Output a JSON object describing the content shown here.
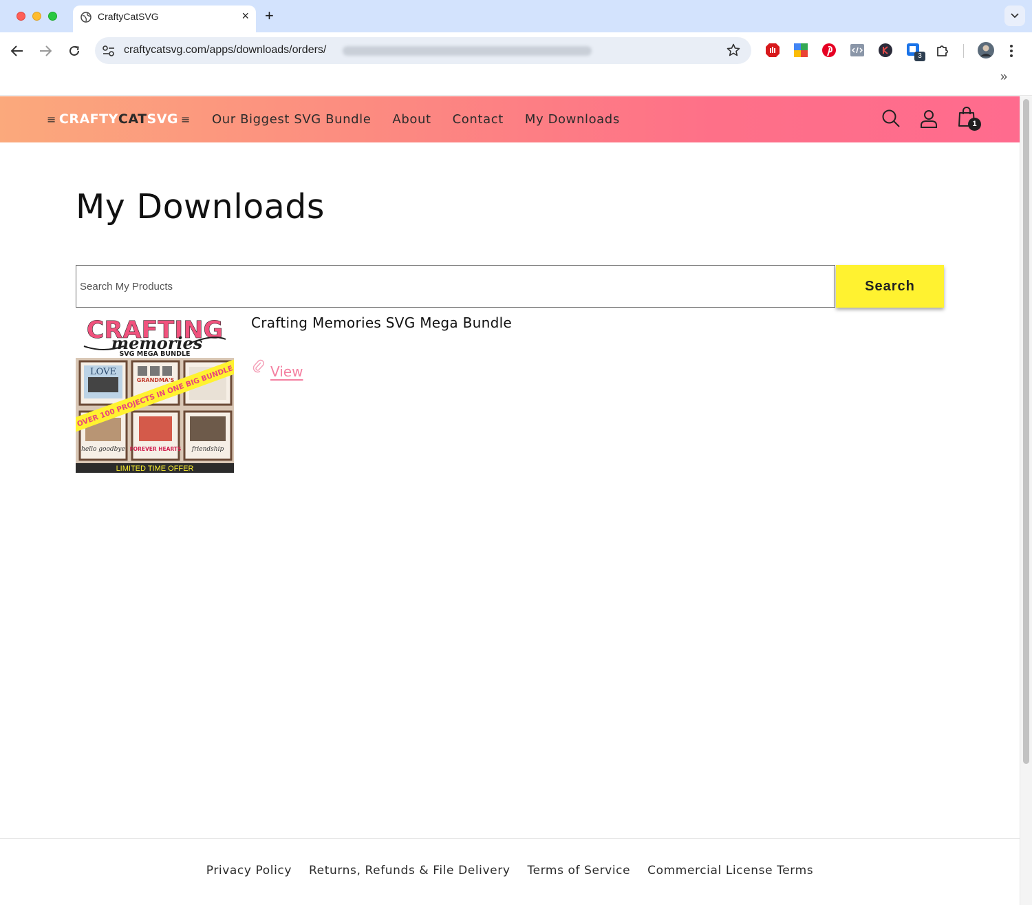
{
  "browser": {
    "tab_title": "CraftyCatSVG",
    "new_tab_symbol": "+",
    "close_symbol": "×",
    "url_visible": "craftycatsvg.com/apps/downloads/orders/",
    "extensions": [
      "adblock-icon",
      "translate-icon",
      "pinterest-icon",
      "devtools-icon",
      "k-extension-icon",
      "tab-counter-icon",
      "puzzle-icon",
      "profile-avatar"
    ],
    "extension_badge": "3",
    "overflow_chevron": "»"
  },
  "site": {
    "logo": {
      "part1": "CRAFTY",
      "part2": "CAT",
      "part3": "SVG"
    },
    "nav": [
      {
        "label": "Our Biggest SVG Bundle"
      },
      {
        "label": "About"
      },
      {
        "label": "Contact"
      },
      {
        "label": "My Downloads"
      }
    ],
    "cart_count": "1",
    "colors": {
      "header_start": "#fba97c",
      "header_end": "#ff6b8e",
      "accent": "#f47fa0",
      "search_button": "#fff230"
    }
  },
  "main": {
    "title": "My Downloads",
    "search": {
      "placeholder": "Search My Products",
      "button_label": "Search"
    },
    "products": [
      {
        "title": "Crafting Memories SVG Mega Bundle",
        "view_label": "View",
        "thumb": {
          "heading": "CRAFTING",
          "script": "memories",
          "sub": "SVG MEGA BUNDLE",
          "banner": "OVER 100 PROJECTS IN ONE BIG BUNDLE",
          "footer": "LIMITED TIME OFFER",
          "frame_labels": [
            "LOVE",
            "GRANDMA'S",
            "FOREVER HEARTS",
            "friendship",
            "hello goodbye"
          ]
        }
      }
    ]
  },
  "footer": {
    "links": [
      {
        "label": "Privacy Policy"
      },
      {
        "label": "Returns, Refunds & File Delivery"
      },
      {
        "label": "Terms of Service"
      },
      {
        "label": "Commercial License Terms"
      }
    ]
  }
}
